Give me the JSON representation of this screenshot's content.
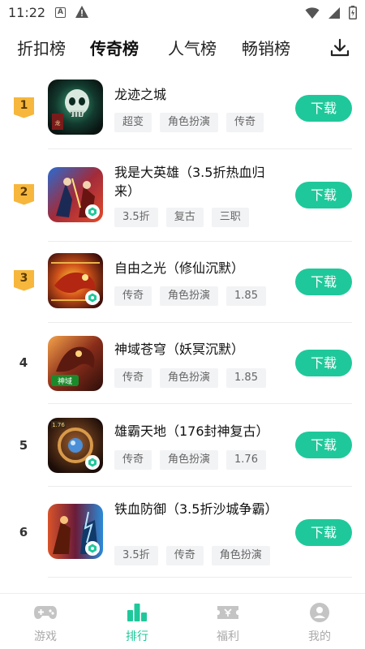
{
  "status_bar": {
    "time": "11:22",
    "a_icon": "A"
  },
  "tabs": [
    {
      "label": "折扣榜",
      "active": false
    },
    {
      "label": "传奇榜",
      "active": true
    },
    {
      "label": "人气榜",
      "active": false
    },
    {
      "label": "畅销榜",
      "active": false
    }
  ],
  "download_manager_icon": "download-tray-icon",
  "games": [
    {
      "rank": "1",
      "title": "龙迹之城",
      "tags": [
        "超变",
        "角色扮演",
        "传奇"
      ],
      "button": "下载"
    },
    {
      "rank": "2",
      "title": "我是大英雄（3.5折热血归来）",
      "tags": [
        "3.5折",
        "复古",
        "三职"
      ],
      "button": "下载"
    },
    {
      "rank": "3",
      "title": "自由之光（修仙沉默）",
      "tags": [
        "传奇",
        "角色扮演",
        "1.85"
      ],
      "button": "下载"
    },
    {
      "rank": "4",
      "title": "神域苍穹（妖冥沉默）",
      "tags": [
        "传奇",
        "角色扮演",
        "1.85"
      ],
      "button": "下载"
    },
    {
      "rank": "5",
      "title": "雄霸天地（176封神复古）",
      "tags": [
        "传奇",
        "角色扮演",
        "1.76"
      ],
      "button": "下载"
    },
    {
      "rank": "6",
      "title": "铁血防御（3.5折沙城争霸）",
      "tags": [
        "3.5折",
        "传奇",
        "角色扮演"
      ],
      "button": "下载"
    }
  ],
  "bottom_nav": [
    {
      "label": "游戏",
      "icon": "gamepad-icon",
      "active": false
    },
    {
      "label": "排行",
      "icon": "bar-chart-icon",
      "active": true
    },
    {
      "label": "福利",
      "icon": "coupon-icon",
      "active": false
    },
    {
      "label": "我的",
      "icon": "user-icon",
      "active": false
    }
  ],
  "colors": {
    "accent": "#1fc89a",
    "tab_highlight": "#7ee5c8",
    "rank_badge": "#f6b73c"
  }
}
